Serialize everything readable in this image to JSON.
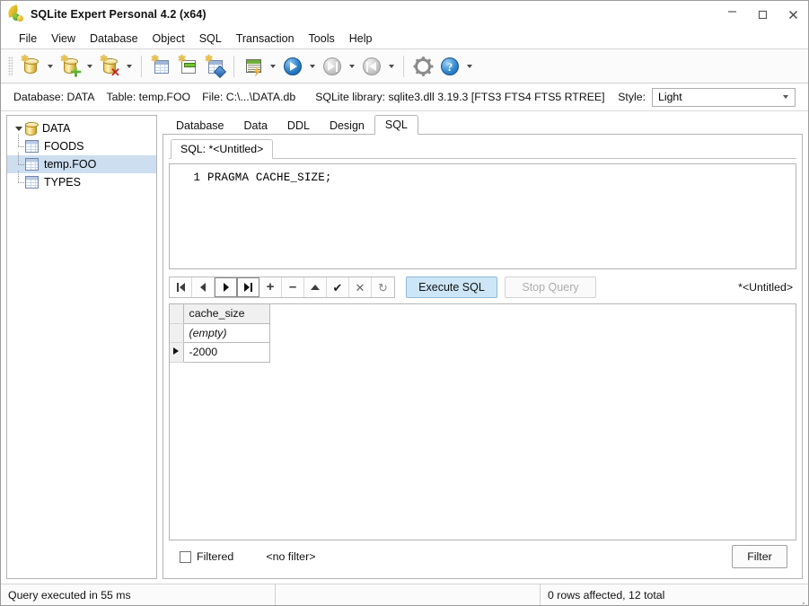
{
  "window": {
    "title": "SQLite Expert Personal 4.2 (x64)",
    "icon": "sqlite-expert-app-icon",
    "controls": {
      "minimize": "–",
      "maximize": "□",
      "close": "✕"
    }
  },
  "menu": {
    "items": [
      "File",
      "View",
      "Database",
      "Object",
      "SQL",
      "Transaction",
      "Tools",
      "Help"
    ]
  },
  "toolbar": {
    "buttons": [
      {
        "name": "open-database",
        "icon": "database-cylinder-icon",
        "has_dropdown": true
      },
      {
        "name": "new-database",
        "icon": "database-add-icon",
        "has_dropdown": true
      },
      {
        "name": "delete-database",
        "icon": "database-delete-icon",
        "has_dropdown": true
      },
      {
        "name": "new-table",
        "icon": "table-new-icon",
        "has_dropdown": false
      },
      {
        "name": "new-view",
        "icon": "view-new-icon",
        "has_dropdown": false
      },
      {
        "name": "new-index",
        "icon": "index-new-icon",
        "has_dropdown": false
      },
      {
        "name": "new-sql-tab",
        "icon": "sql-script-icon",
        "has_dropdown": true
      },
      {
        "name": "execute",
        "icon": "play-blue-icon",
        "has_dropdown": true
      },
      {
        "name": "step-forward",
        "icon": "step-forward-gray-icon",
        "has_dropdown": true
      },
      {
        "name": "step-back",
        "icon": "step-back-gray-icon",
        "has_dropdown": true
      },
      {
        "name": "options",
        "icon": "gear-icon",
        "has_dropdown": false
      },
      {
        "name": "help",
        "icon": "help-question-icon",
        "has_dropdown": true
      }
    ]
  },
  "infobar": {
    "database": "Database: DATA",
    "table": "Table: temp.FOO",
    "file": "File: C:\\...\\DATA.db",
    "library": "SQLite library: sqlite3.dll 3.19.3 [FTS3 FTS4 FTS5 RTREE]",
    "style_label": "Style:",
    "style_value": "Light"
  },
  "tree": {
    "root": {
      "label": "DATA",
      "icon": "database-cylinder-icon",
      "expanded": true
    },
    "children": [
      {
        "label": "FOODS",
        "icon": "table-icon",
        "selected": false
      },
      {
        "label": "temp.FOO",
        "icon": "table-icon",
        "selected": true
      },
      {
        "label": "TYPES",
        "icon": "table-icon",
        "selected": false
      }
    ]
  },
  "tabs": {
    "items": [
      "Database",
      "Data",
      "DDL",
      "Design",
      "SQL"
    ],
    "active": "SQL"
  },
  "subtabs": {
    "items": [
      "SQL: *<Untitled>"
    ],
    "active": "SQL: *<Untitled>"
  },
  "editor": {
    "lines": [
      {
        "number": "1",
        "text": "PRAGMA CACHE_SIZE;"
      }
    ]
  },
  "navbar": {
    "buttons": [
      {
        "name": "first-record-button",
        "icon": "first-icon"
      },
      {
        "name": "prior-record-button",
        "icon": "prior-icon"
      },
      {
        "name": "next-record-button",
        "icon": "next-icon"
      },
      {
        "name": "last-record-button",
        "icon": "last-icon"
      },
      {
        "name": "insert-record-button",
        "icon": "plus-icon",
        "glyph": "+"
      },
      {
        "name": "delete-record-button",
        "icon": "minus-icon",
        "glyph": "–"
      },
      {
        "name": "edit-record-button",
        "icon": "up-triangle-icon"
      },
      {
        "name": "post-edit-button",
        "icon": "checkmark-icon",
        "glyph": "✔"
      },
      {
        "name": "cancel-edit-button",
        "icon": "cross-icon",
        "glyph": "✕"
      },
      {
        "name": "refresh-button",
        "icon": "refresh-icon",
        "glyph": "↻"
      }
    ],
    "execute_label": "Execute SQL",
    "stop_label": "Stop Query",
    "right_label": "*<Untitled>"
  },
  "grid": {
    "columns": [
      "cache_size"
    ],
    "filter_row": [
      "(empty)"
    ],
    "rows": [
      {
        "indicator": "current",
        "cells": [
          "-2000"
        ]
      }
    ]
  },
  "filterbar": {
    "checkbox_label": "Filtered",
    "checked": false,
    "filter_text": "<no filter>",
    "filter_button": "Filter"
  },
  "statusbar": {
    "left": "Query executed in 55 ms",
    "middle": "",
    "right": "0 rows affected, 12 total"
  },
  "colors": {
    "accent_button": "#cde6f7",
    "tree_selection": "#cddef0",
    "toolbar_bg": "#fbfbfb",
    "border": "#b4b4b4"
  }
}
